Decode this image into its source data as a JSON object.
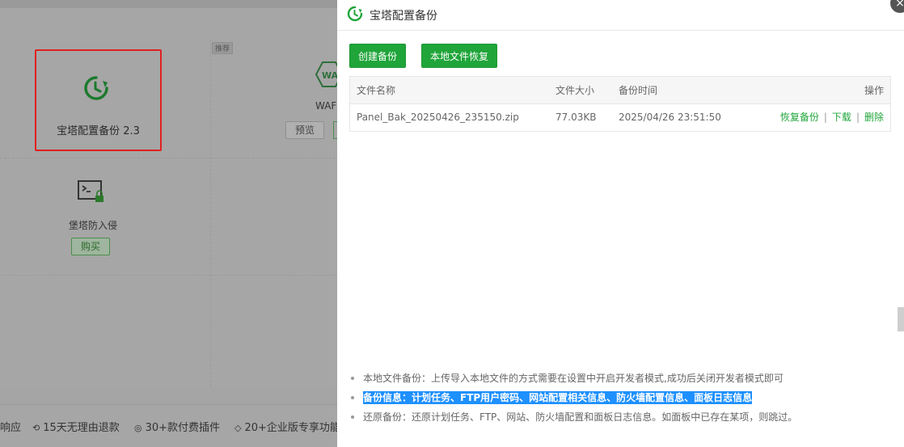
{
  "background": {
    "highlighted_plugin": {
      "name": "宝塔配置备份 2.3"
    },
    "recommend_tag": "推荐",
    "waf_plugin": {
      "icon_text": "WAF",
      "name": "WAF",
      "preview_label": "预览"
    },
    "guard_plugin": {
      "name": "堡塔防入侵",
      "buy_label": "购买"
    },
    "footer": [
      {
        "text": "响应",
        "icon": ""
      },
      {
        "text": "15天无理由退款",
        "icon": "refund-icon"
      },
      {
        "text": "30+款付费插件",
        "icon": "plugin-icon"
      },
      {
        "text": "20+企业版专享功能",
        "icon": "diamond-icon"
      }
    ]
  },
  "dialog": {
    "title": "宝塔配置备份",
    "close_glyph": "×",
    "buttons": {
      "create": "创建备份",
      "restore_local": "本地文件恢复"
    },
    "table": {
      "headers": [
        "文件名称",
        "文件大小",
        "备份时间",
        "操作"
      ],
      "rows": [
        {
          "name": "Panel_Bak_20250426_235150.zip",
          "size": "77.03KB",
          "time": "2025/04/26 23:51:50",
          "actions": {
            "restore": "恢复备份",
            "download": "下载",
            "delete": "删除",
            "separator": "|"
          }
        }
      ]
    },
    "notes": [
      "本地文件备份：上传导入本地文件的方式需要在设置中开启开发者模式,成功后关闭开发者模式即可",
      "备份信息：计划任务、FTP用户密码、网站配置相关信息、防火墙配置信息、面板日志信息",
      "还原备份：还原计划任务、FTP、网站、防火墙配置和面板日志信息。如面板中已存在某项，则跳过。"
    ]
  },
  "colors": {
    "accent": "#20a53a",
    "highlight_border": "#e02020",
    "selection": "#1e90ff"
  }
}
